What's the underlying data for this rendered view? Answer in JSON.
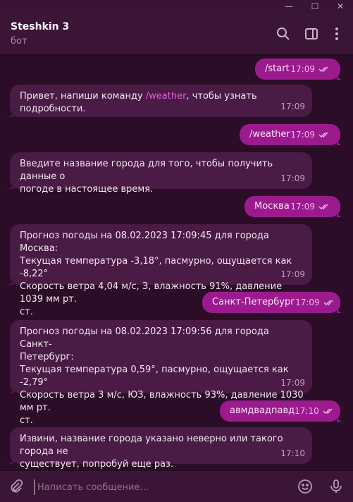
{
  "window": {
    "minimize_glyph": "—",
    "maximize_glyph": "☐",
    "close_glyph": "✕"
  },
  "header": {
    "title": "Steshkin 3",
    "subtitle": "бот",
    "icons": [
      "search-icon",
      "sidebar-toggle-icon",
      "more-options-icon"
    ]
  },
  "messages": [
    {
      "dir": "out",
      "text": "/start",
      "time": "17:09",
      "read": true
    },
    {
      "dir": "in",
      "text_before": "Привет, напиши команду ",
      "command": "/weather",
      "text_after": ", чтобы узнать подробности.",
      "time": "17:09"
    },
    {
      "dir": "out",
      "text": "/weather",
      "time": "17:09",
      "read": true
    },
    {
      "dir": "in",
      "text": "Введите название города для того, чтобы получить данные о\nпогоде в настоящее время.",
      "time": "17:09"
    },
    {
      "dir": "out",
      "text": "Москва",
      "time": "17:09",
      "read": true
    },
    {
      "dir": "in",
      "text": "Прогноз погоды на 08.02.2023 17:09:45 для города Москва:\nТекущая температура -3,18°, пасмурно, ощущается как -8,22°\nСкорость ветра 4,04 м/с, З, влажность 91%, давление 1039 мм рт.\nст.",
      "time": "17:09"
    },
    {
      "dir": "out",
      "text": "Санкт-Петербург",
      "time": "17:09",
      "read": true
    },
    {
      "dir": "in",
      "text": "Прогноз погоды на 08.02.2023 17:09:56 для города Санкт-\nПетербург:\nТекущая температура 0,59°, пасмурно, ощущается как -2,79°\nСкорость ветра 3 м/с, ЮЗ, влажность 93%, давление 1030 мм рт.\nст.",
      "time": "17:09"
    },
    {
      "dir": "out",
      "text": "авмдвадпавд",
      "time": "17:10",
      "read": true
    },
    {
      "dir": "in",
      "text": "Извини, название города указано неверно или такого города не\nсуществует, попробуй еще раз.",
      "time": "17:10"
    }
  ],
  "composer": {
    "placeholder": "Написать сообщение...",
    "icons": [
      "attach-icon",
      "emoji-icon",
      "microphone-icon"
    ]
  },
  "colors": {
    "background": "#2b0d27",
    "header": "#3b1536",
    "incoming_bubble": "#4a1b44",
    "outgoing_bubble": "#9b1b8e",
    "accent": "#e65be0"
  }
}
